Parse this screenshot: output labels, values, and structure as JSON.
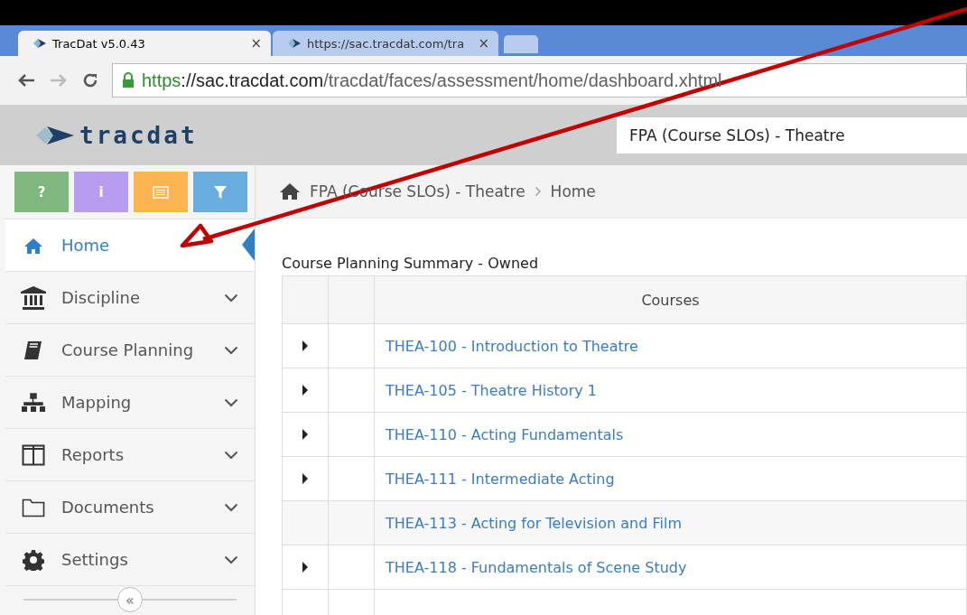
{
  "browser": {
    "tabs": [
      {
        "title": "TracDat v5.0.43",
        "close": "×",
        "selected": true
      },
      {
        "title": "https://sac.tracdat.com/tra",
        "close": "×",
        "selected": false
      }
    ],
    "url": {
      "scheme": "https",
      "host": "://sac.tracdat.com",
      "path": "/tracdat/faces/assessment/home/dashboard.xhtml"
    }
  },
  "header": {
    "logo": "tracdat",
    "project": "FPA (Course SLOs) - Theatre"
  },
  "toolbar_buttons": [
    {
      "label": "?",
      "color": "#7fb77e"
    },
    {
      "label": "i",
      "color": "#b89cf0"
    },
    {
      "kind": "list",
      "color": "#fbb450"
    },
    {
      "kind": "filter",
      "color": "#6aaee0"
    }
  ],
  "sidebar": {
    "items": [
      {
        "label": "Home",
        "selected": true,
        "expandable": false
      },
      {
        "label": "Discipline",
        "selected": false,
        "expandable": true
      },
      {
        "label": "Course Planning",
        "selected": false,
        "expandable": true
      },
      {
        "label": "Mapping",
        "selected": false,
        "expandable": true
      },
      {
        "label": "Reports",
        "selected": false,
        "expandable": true
      },
      {
        "label": "Documents",
        "selected": false,
        "expandable": true
      },
      {
        "label": "Settings",
        "selected": false,
        "expandable": true
      }
    ],
    "collapse": "«"
  },
  "breadcrumb": [
    "FPA (Course SLOs) - Theatre",
    "Home"
  ],
  "table": {
    "title": "Course Planning Summary - Owned",
    "columns": [
      "",
      "",
      "Courses"
    ],
    "rows": [
      {
        "course": "THEA-100 - Introduction to Theatre",
        "expandable": true,
        "highlighted": false
      },
      {
        "course": "THEA-105 - Theatre History 1",
        "expandable": true,
        "highlighted": false
      },
      {
        "course": "THEA-110 - Acting Fundamentals",
        "expandable": true,
        "highlighted": false
      },
      {
        "course": "THEA-111 - Intermediate Acting",
        "expandable": true,
        "highlighted": false
      },
      {
        "course": "THEA-113 - Acting for Television and Film",
        "expandable": false,
        "highlighted": true
      },
      {
        "course": "THEA-118 - Fundamentals of Scene Study",
        "expandable": true,
        "highlighted": false
      }
    ]
  }
}
